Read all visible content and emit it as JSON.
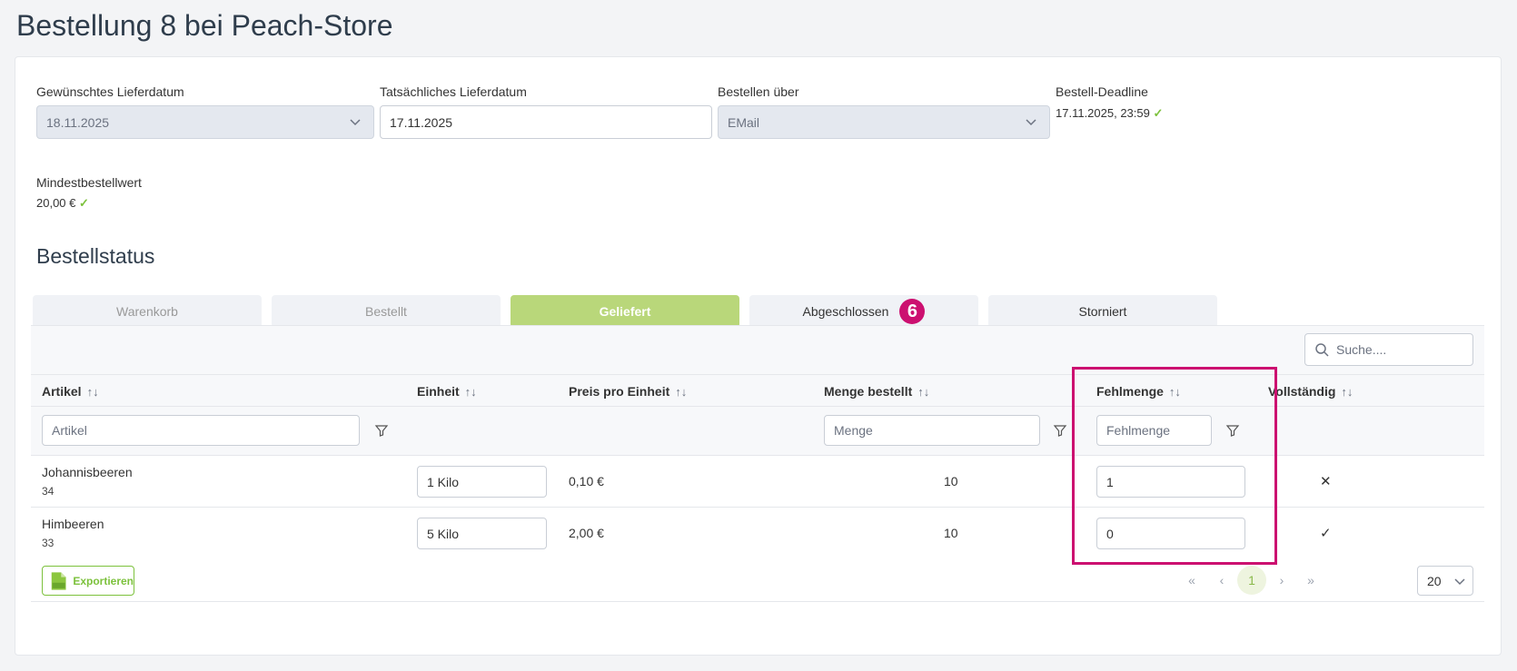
{
  "page": {
    "title": "Bestellung 8 bei Peach-Store"
  },
  "fields": {
    "desired_date": {
      "label": "Gewünschtes Lieferdatum",
      "value": "18.11.2025"
    },
    "actual_date": {
      "label": "Tatsächliches Lieferdatum",
      "value": "17.11.2025"
    },
    "order_via": {
      "label": "Bestellen über",
      "value": "EMail"
    },
    "deadline": {
      "label": "Bestell-Deadline",
      "value": "17.11.2025, 23:59",
      "ok": "✓"
    },
    "min_order": {
      "label": "Mindestbestellwert",
      "value": "20,00 €",
      "ok": "✓"
    }
  },
  "status": {
    "title": "Bestellstatus",
    "steps": [
      {
        "label": "Warenkorb"
      },
      {
        "label": "Bestellt"
      },
      {
        "label": "Geliefert"
      },
      {
        "label": "Abgeschlossen",
        "badge": "6"
      },
      {
        "label": "Storniert"
      }
    ]
  },
  "table": {
    "search_placeholder": "Suche....",
    "columns": [
      "Artikel",
      "Einheit",
      "Preis pro Einheit",
      "Menge bestellt",
      "Fehlmenge",
      "Vollständig"
    ],
    "sort_icon": "↑↓",
    "filters": {
      "artikel": "Artikel",
      "menge": "Menge",
      "fehlmenge": "Fehlmenge"
    },
    "rows": [
      {
        "name": "Johannisbeeren",
        "id": "34",
        "unit": "1 Kilo",
        "price": "0,10 €",
        "qty": "10",
        "missing": "1",
        "complete": "✕"
      },
      {
        "name": "Himbeeren",
        "id": "33",
        "unit": "5 Kilo",
        "price": "2,00 €",
        "qty": "10",
        "missing": "0",
        "complete": "✓"
      }
    ],
    "export_label": "Exportieren",
    "pagination": {
      "first": "«",
      "prev": "‹",
      "current": "1",
      "next": "›",
      "last": "»",
      "rows_per_page": "20"
    }
  },
  "colors": {
    "accent": "#b9d77a",
    "highlight": "#cc1070",
    "ok": "#7cc13c"
  }
}
